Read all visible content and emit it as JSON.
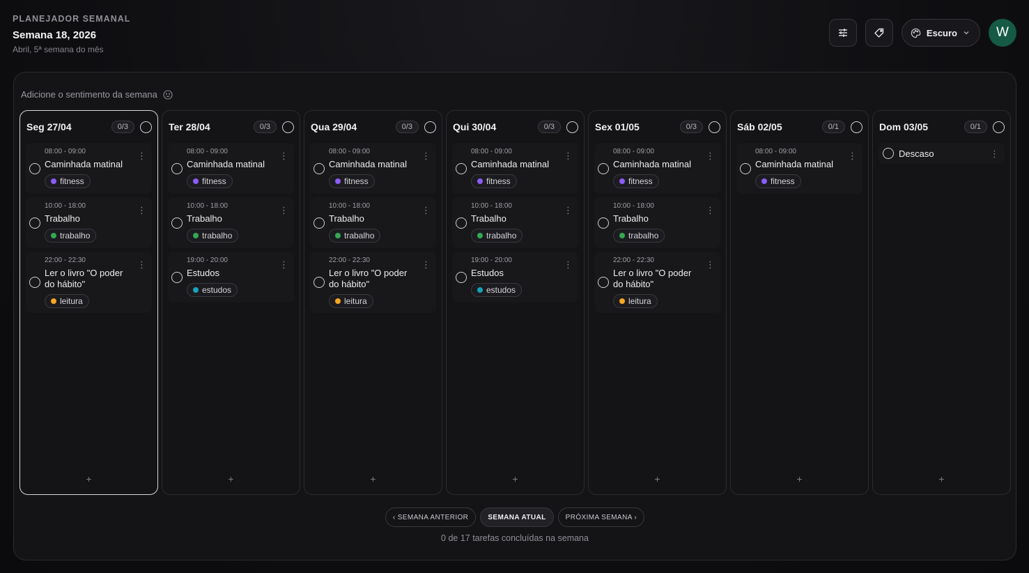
{
  "header": {
    "kicker": "PLANEJADOR SEMANAL",
    "title": "Semana 18, 2026",
    "subtitle": "Abril, 5ª semana do mês",
    "theme_label": "Escuro",
    "avatar_letter": "W"
  },
  "sentiment": {
    "placeholder": "Adicione o sentimento da semana"
  },
  "days": [
    {
      "name": "Seg 27/04",
      "count": "0/3",
      "today": true,
      "tasks": [
        {
          "time": "08:00 - 09:00",
          "title": "Caminhada matinal",
          "tag": "fitness",
          "tag_color": "#8b5cf6"
        },
        {
          "time": "10:00 - 18:00",
          "title": "Trabalho",
          "tag": "trabalho",
          "tag_color": "#34a853"
        },
        {
          "time": "22:00 - 22:30",
          "title": "Ler o livro \"O poder do hábito\"",
          "tag": "leitura",
          "tag_color": "#f5a623"
        }
      ]
    },
    {
      "name": "Ter 28/04",
      "count": "0/3",
      "tasks": [
        {
          "time": "08:00 - 09:00",
          "title": "Caminhada matinal",
          "tag": "fitness",
          "tag_color": "#8b5cf6"
        },
        {
          "time": "10:00 - 18:00",
          "title": "Trabalho",
          "tag": "trabalho",
          "tag_color": "#34a853"
        },
        {
          "time": "19:00 - 20:00",
          "title": "Estudos",
          "tag": "estudos",
          "tag_color": "#17a2b8"
        }
      ]
    },
    {
      "name": "Qua 29/04",
      "count": "0/3",
      "tasks": [
        {
          "time": "08:00 - 09:00",
          "title": "Caminhada matinal",
          "tag": "fitness",
          "tag_color": "#8b5cf6"
        },
        {
          "time": "10:00 - 18:00",
          "title": "Trabalho",
          "tag": "trabalho",
          "tag_color": "#34a853"
        },
        {
          "time": "22:00 - 22:30",
          "title": "Ler o livro \"O poder do hábito\"",
          "tag": "leitura",
          "tag_color": "#f5a623"
        }
      ]
    },
    {
      "name": "Qui 30/04",
      "count": "0/3",
      "tasks": [
        {
          "time": "08:00 - 09:00",
          "title": "Caminhada matinal",
          "tag": "fitness",
          "tag_color": "#8b5cf6"
        },
        {
          "time": "10:00 - 18:00",
          "title": "Trabalho",
          "tag": "trabalho",
          "tag_color": "#34a853"
        },
        {
          "time": "19:00 - 20:00",
          "title": "Estudos",
          "tag": "estudos",
          "tag_color": "#17a2b8"
        }
      ]
    },
    {
      "name": "Sex 01/05",
      "count": "0/3",
      "tasks": [
        {
          "time": "08:00 - 09:00",
          "title": "Caminhada matinal",
          "tag": "fitness",
          "tag_color": "#8b5cf6"
        },
        {
          "time": "10:00 - 18:00",
          "title": "Trabalho",
          "tag": "trabalho",
          "tag_color": "#34a853"
        },
        {
          "time": "22:00 - 22:30",
          "title": "Ler o livro \"O poder do hábito\"",
          "tag": "leitura",
          "tag_color": "#f5a623"
        }
      ]
    },
    {
      "name": "Sáb 02/05",
      "count": "0/1",
      "tasks": [
        {
          "time": "08:00 - 09:00",
          "title": "Caminhada matinal",
          "tag": "fitness",
          "tag_color": "#8b5cf6"
        }
      ]
    },
    {
      "name": "Dom 03/05",
      "count": "0/1",
      "tasks": [
        {
          "title": "Descaso"
        }
      ]
    }
  ],
  "add_label": "+",
  "nav": {
    "prev": "‹ SEMANA ANTERIOR",
    "current": "SEMANA ATUAL",
    "next": "PRÓXIMA SEMANA ›"
  },
  "summary": "0 de 17 tarefas concluídas na semana"
}
